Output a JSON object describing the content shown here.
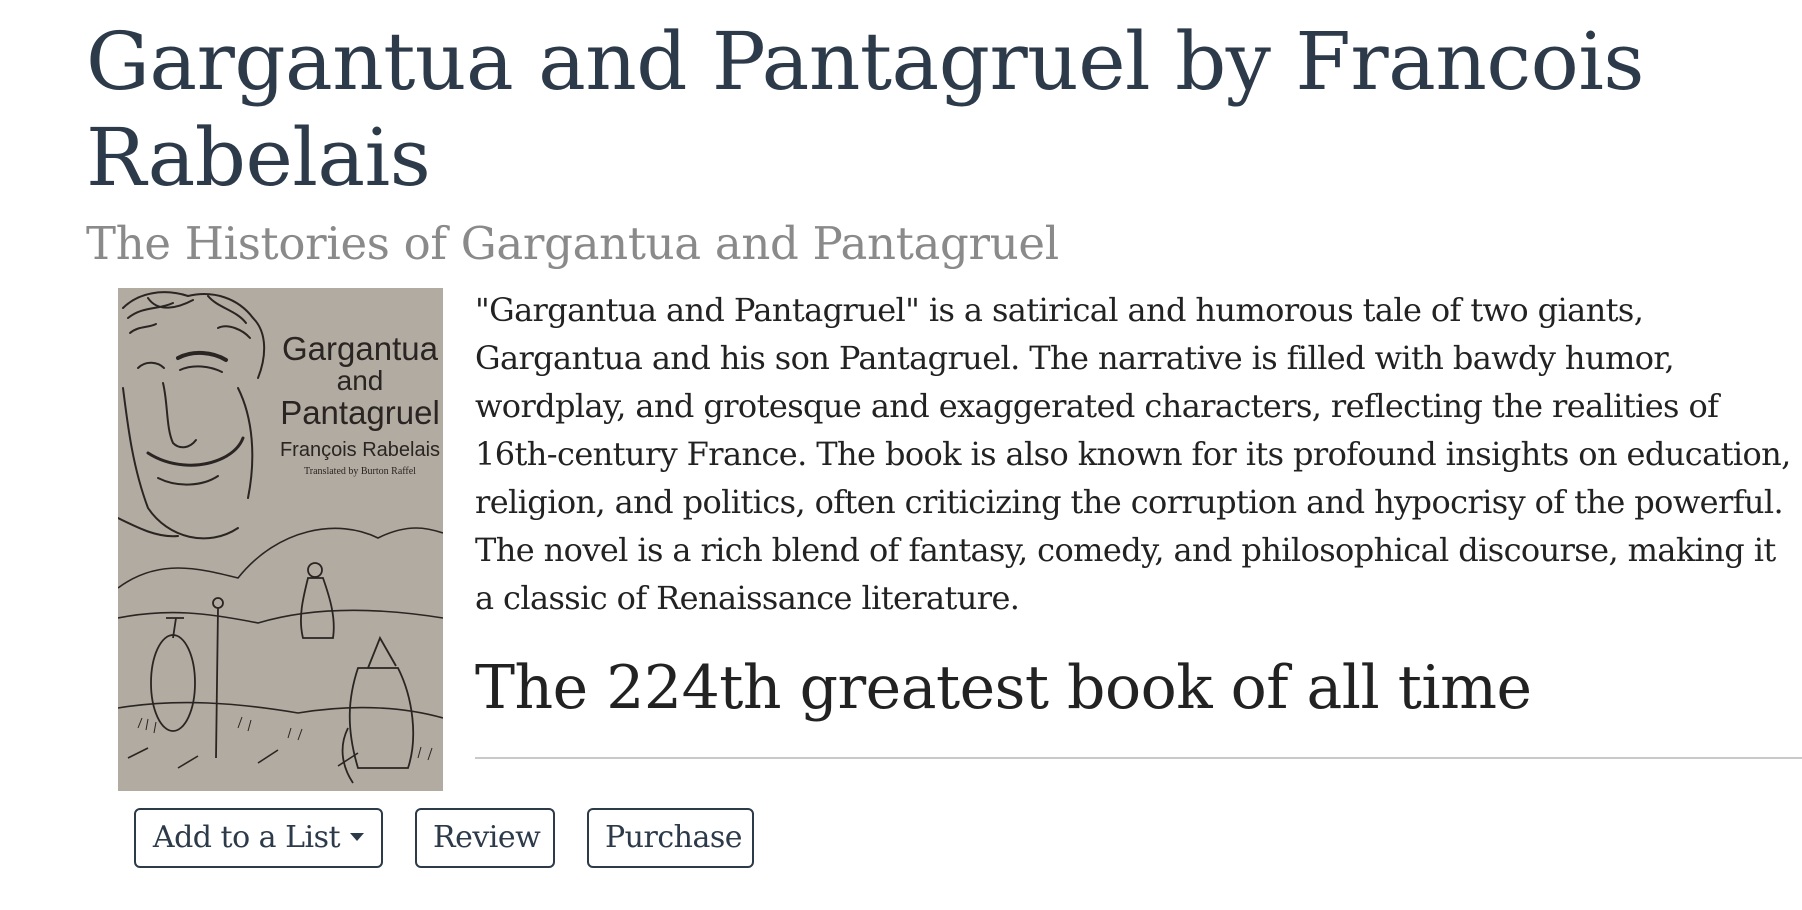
{
  "book": {
    "title": "Gargantua and Pantagruel by Francois Rabelais",
    "subtitle": "The Histories of Gargantua and Pantagruel",
    "description": "\"Gargantua and Pantagruel\" is a satirical and humorous tale of two giants, Gargantua and his son Pantagruel. The narrative is filled with bawdy humor, wordplay, and grotesque and exaggerated characters, reflecting the realities of 16th-century France. The book is also known for its profound insights on education, religion, and politics, often criticizing the corruption and hypocrisy of the powerful. The novel is a rich blend of fantasy, comedy, and philosophical discourse, making it a classic of Renaissance literature.",
    "rank": "The 224th greatest book of all time"
  },
  "cover": {
    "title_line1": "Gargantua",
    "title_line2": "and",
    "title_line3": "Pantagruel",
    "author": "François Rabelais",
    "translator": "Translated by Burton Raffel",
    "background_color": "#b2aba2",
    "ink_color": "#2a2522"
  },
  "actions": {
    "add_to_list": "Add to a List",
    "review": "Review",
    "purchase": "Purchase"
  },
  "colors": {
    "title": "#2c3a4a",
    "subtitle": "#8a8a8a",
    "body_text": "#222222",
    "button_border": "#2c3a4a",
    "divider": "#c9c9c9"
  }
}
